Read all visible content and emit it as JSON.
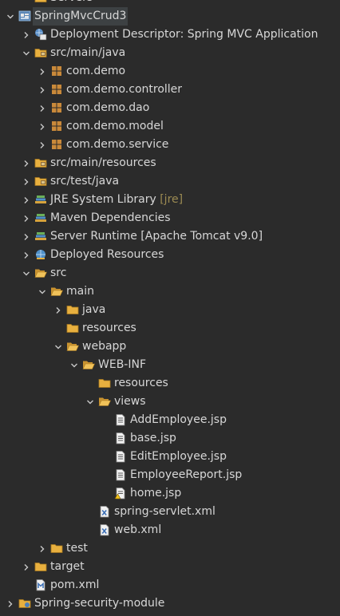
{
  "tree": [
    {
      "label": "Servers",
      "decor": "",
      "icon": "folder-icon",
      "expander": "none",
      "depth": 1,
      "selected": false
    },
    {
      "label": "SpringMvcCrud3",
      "decor": "",
      "icon": "web-project-icon",
      "expander": "expanded",
      "depth": 0,
      "selected": true
    },
    {
      "label": "Deployment Descriptor: Spring MVC Application",
      "decor": "",
      "icon": "deployment-descriptor-icon",
      "expander": "collapsed",
      "depth": 1,
      "selected": false
    },
    {
      "label": "src/main/java",
      "decor": "",
      "icon": "source-folder-icon",
      "expander": "expanded",
      "depth": 1,
      "selected": false
    },
    {
      "label": "com.demo",
      "decor": "",
      "icon": "package-icon",
      "expander": "collapsed",
      "depth": 2,
      "selected": false
    },
    {
      "label": "com.demo.controller",
      "decor": "",
      "icon": "package-icon",
      "expander": "collapsed",
      "depth": 2,
      "selected": false
    },
    {
      "label": "com.demo.dao",
      "decor": "",
      "icon": "package-icon",
      "expander": "collapsed",
      "depth": 2,
      "selected": false
    },
    {
      "label": "com.demo.model",
      "decor": "",
      "icon": "package-icon",
      "expander": "collapsed",
      "depth": 2,
      "selected": false
    },
    {
      "label": "com.demo.service",
      "decor": "",
      "icon": "package-icon",
      "expander": "collapsed",
      "depth": 2,
      "selected": false
    },
    {
      "label": "src/main/resources",
      "decor": "",
      "icon": "source-folder-icon",
      "expander": "collapsed",
      "depth": 1,
      "selected": false
    },
    {
      "label": "src/test/java",
      "decor": "",
      "icon": "source-folder-icon",
      "expander": "collapsed",
      "depth": 1,
      "selected": false
    },
    {
      "label": "JRE System Library",
      "decor": "[jre]",
      "icon": "library-icon",
      "expander": "collapsed",
      "depth": 1,
      "selected": false
    },
    {
      "label": "Maven Dependencies",
      "decor": "",
      "icon": "library-icon",
      "expander": "collapsed",
      "depth": 1,
      "selected": false
    },
    {
      "label": "Server Runtime [Apache Tomcat v9.0]",
      "decor": "",
      "icon": "library-icon",
      "expander": "collapsed",
      "depth": 1,
      "selected": false
    },
    {
      "label": "Deployed Resources",
      "decor": "",
      "icon": "deployed-resources-icon",
      "expander": "collapsed",
      "depth": 1,
      "selected": false
    },
    {
      "label": "src",
      "decor": "",
      "icon": "open-folder-icon",
      "expander": "expanded",
      "depth": 1,
      "selected": false
    },
    {
      "label": "main",
      "decor": "",
      "icon": "open-folder-icon",
      "expander": "expanded",
      "depth": 2,
      "selected": false
    },
    {
      "label": "java",
      "decor": "",
      "icon": "folder-icon",
      "expander": "collapsed",
      "depth": 3,
      "selected": false
    },
    {
      "label": "resources",
      "decor": "",
      "icon": "folder-icon",
      "expander": "none",
      "depth": 3,
      "selected": false
    },
    {
      "label": "webapp",
      "decor": "",
      "icon": "open-folder-icon",
      "expander": "expanded",
      "depth": 3,
      "selected": false
    },
    {
      "label": "WEB-INF",
      "decor": "",
      "icon": "open-folder-icon",
      "expander": "expanded",
      "depth": 4,
      "selected": false
    },
    {
      "label": "resources",
      "decor": "",
      "icon": "folder-icon",
      "expander": "none",
      "depth": 5,
      "selected": false
    },
    {
      "label": "views",
      "decor": "",
      "icon": "open-folder-icon",
      "expander": "expanded",
      "depth": 5,
      "selected": false
    },
    {
      "label": "AddEmployee.jsp",
      "decor": "",
      "icon": "jsp-file-icon",
      "expander": "none",
      "depth": 6,
      "selected": false
    },
    {
      "label": "base.jsp",
      "decor": "",
      "icon": "jsp-file-icon",
      "expander": "none",
      "depth": 6,
      "selected": false
    },
    {
      "label": "EditEmployee.jsp",
      "decor": "",
      "icon": "jsp-file-icon",
      "expander": "none",
      "depth": 6,
      "selected": false
    },
    {
      "label": "EmployeeReport.jsp",
      "decor": "",
      "icon": "jsp-file-icon",
      "expander": "none",
      "depth": 6,
      "selected": false
    },
    {
      "label": "home.jsp",
      "decor": "",
      "icon": "jsp-file-warning-icon",
      "expander": "none",
      "depth": 6,
      "selected": false
    },
    {
      "label": "spring-servlet.xml",
      "decor": "",
      "icon": "xml-file-icon",
      "expander": "none",
      "depth": 5,
      "selected": false
    },
    {
      "label": "web.xml",
      "decor": "",
      "icon": "xml-file-icon",
      "expander": "none",
      "depth": 5,
      "selected": false
    },
    {
      "label": "test",
      "decor": "",
      "icon": "folder-icon",
      "expander": "collapsed",
      "depth": 2,
      "selected": false
    },
    {
      "label": "target",
      "decor": "",
      "icon": "folder-icon",
      "expander": "collapsed",
      "depth": 1,
      "selected": false
    },
    {
      "label": "pom.xml",
      "decor": "",
      "icon": "maven-pom-icon",
      "expander": "none",
      "depth": 1,
      "selected": false
    },
    {
      "label": "Spring-security-module",
      "decor": "",
      "icon": "java-project-icon",
      "expander": "collapsed",
      "depth": 0,
      "selected": false
    }
  ],
  "colors": {
    "background": "#2b2b2b",
    "text": "#d7d7d7",
    "decoration": "#9b8a52",
    "selection": "#3d4143",
    "folder": "#e8b03f",
    "package": "#c9893a"
  }
}
